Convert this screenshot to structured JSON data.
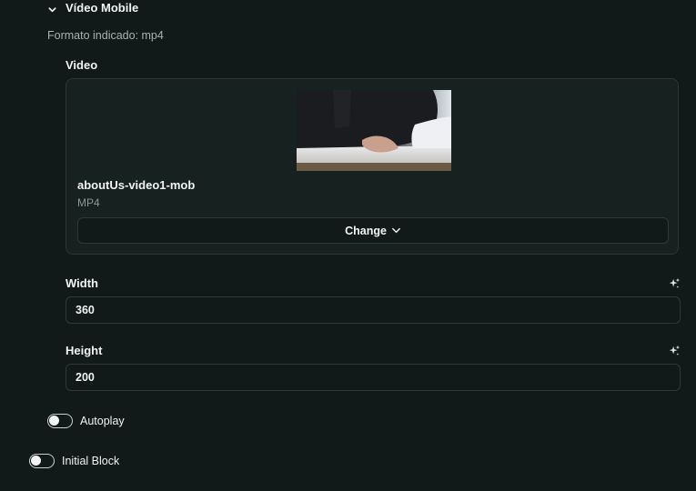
{
  "section": {
    "title": "Vídeo Mobile",
    "hint": "Formato indicado: mp4"
  },
  "video": {
    "label": "Video",
    "file_name": "aboutUs-video1-mob",
    "file_type": "MP4",
    "change_label": "Change"
  },
  "width": {
    "label": "Width",
    "value": "360"
  },
  "height": {
    "label": "Height",
    "value": "200"
  },
  "toggles": {
    "autoplay": {
      "label": "Autoplay",
      "checked": false
    },
    "initial_block": {
      "label": "Initial Block",
      "checked": false
    }
  },
  "icons": {
    "section_toggle": "chevron-down-icon",
    "change_dropdown": "chevron-down-icon",
    "width_ai": "sparkle-icon",
    "height_ai": "sparkle-icon"
  }
}
